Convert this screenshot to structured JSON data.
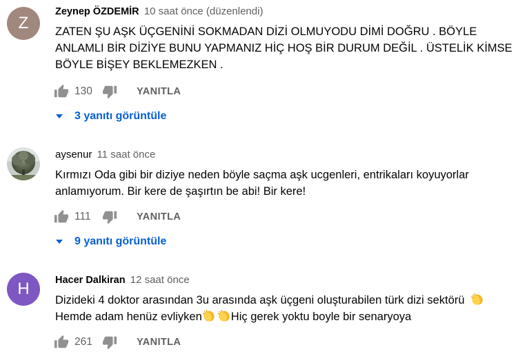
{
  "colors": {
    "link": "#065fd4",
    "secondary_text": "#606060",
    "primary_text": "#030303",
    "avatar_z": "#a1887f",
    "avatar_h": "#7e57c2"
  },
  "comments": [
    {
      "avatar_letter": "Z",
      "author": "Zeynep ÖZDEMİR",
      "time": "10 saat önce (düzenlendi)",
      "lines": [
        "ZATEN ŞU AŞK ÜÇGENİNİ SOKMADAN DİZİ OLMUYODU DİMİ DOĞRU . BÖYLE",
        "ANLAMLI BİR DİZİYE BUNU YAPMANIZ HİÇ HOŞ BİR DURUM DEĞİL . ÜSTELİK KİMSE",
        "BÖYLE BİŞEY BEKLEMEZKEN ."
      ],
      "likes": "130",
      "reply_label": "YANITLA",
      "view_replies": "3 yanıtı görüntüle"
    },
    {
      "avatar_letter": "",
      "author": "aysenur",
      "time": "11 saat önce",
      "lines": [
        "Kırmızı Oda gibi bir diziye neden böyle saçma aşk ucgenleri, entrikaları koyuyorlar",
        "anlamıyorum. Bir kere de şaşırtın be abi! Bir kere!"
      ],
      "likes": "111",
      "reply_label": "YANITLA",
      "view_replies": "9 yanıtı görüntüle"
    },
    {
      "avatar_letter": "H",
      "author": "Hacer Dalkiran",
      "time": "12 saat önce",
      "lines": [
        "Dizideki 4 doktor arasından 3u arasında aşk üçgeni oluşturabilen türk dizi sektörü",
        "Hemde adam henüz evliyken",
        "Hiç gerek yoktu boyle bir senaryoya"
      ],
      "likes": "261",
      "reply_label": "YANITLA"
    }
  ]
}
